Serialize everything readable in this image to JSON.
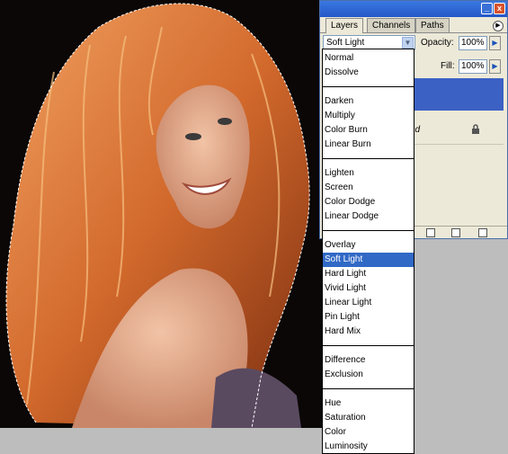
{
  "palette": {
    "tabs": [
      "Layers",
      "Channels",
      "Paths"
    ],
    "active_tab": "Layers",
    "menu_icon": "flyout-triangle-icon",
    "blend_mode": "Soft Light",
    "opacity_label": "Opacity:",
    "opacity_value": "100%",
    "fill_label": "Fill:",
    "fill_value": "100%",
    "layer_name_fragment": "nd",
    "layer_lock_icon": "lock-icon",
    "window_buttons": [
      "_",
      "x"
    ]
  },
  "blend_modes": {
    "groups": [
      [
        "Normal",
        "Dissolve"
      ],
      [
        "Darken",
        "Multiply",
        "Color Burn",
        "Linear Burn"
      ],
      [
        "Lighten",
        "Screen",
        "Color Dodge",
        "Linear Dodge"
      ],
      [
        "Overlay",
        "Soft Light",
        "Hard Light",
        "Vivid Light",
        "Linear Light",
        "Pin Light",
        "Hard Mix"
      ],
      [
        "Difference",
        "Exclusion"
      ],
      [
        "Hue",
        "Saturation",
        "Color",
        "Luminosity"
      ]
    ],
    "selected": "Soft Light"
  },
  "colors": {
    "selection_highlight": "#3169c6",
    "titlebar": "#2d62d4",
    "hair": "#c8612a"
  }
}
